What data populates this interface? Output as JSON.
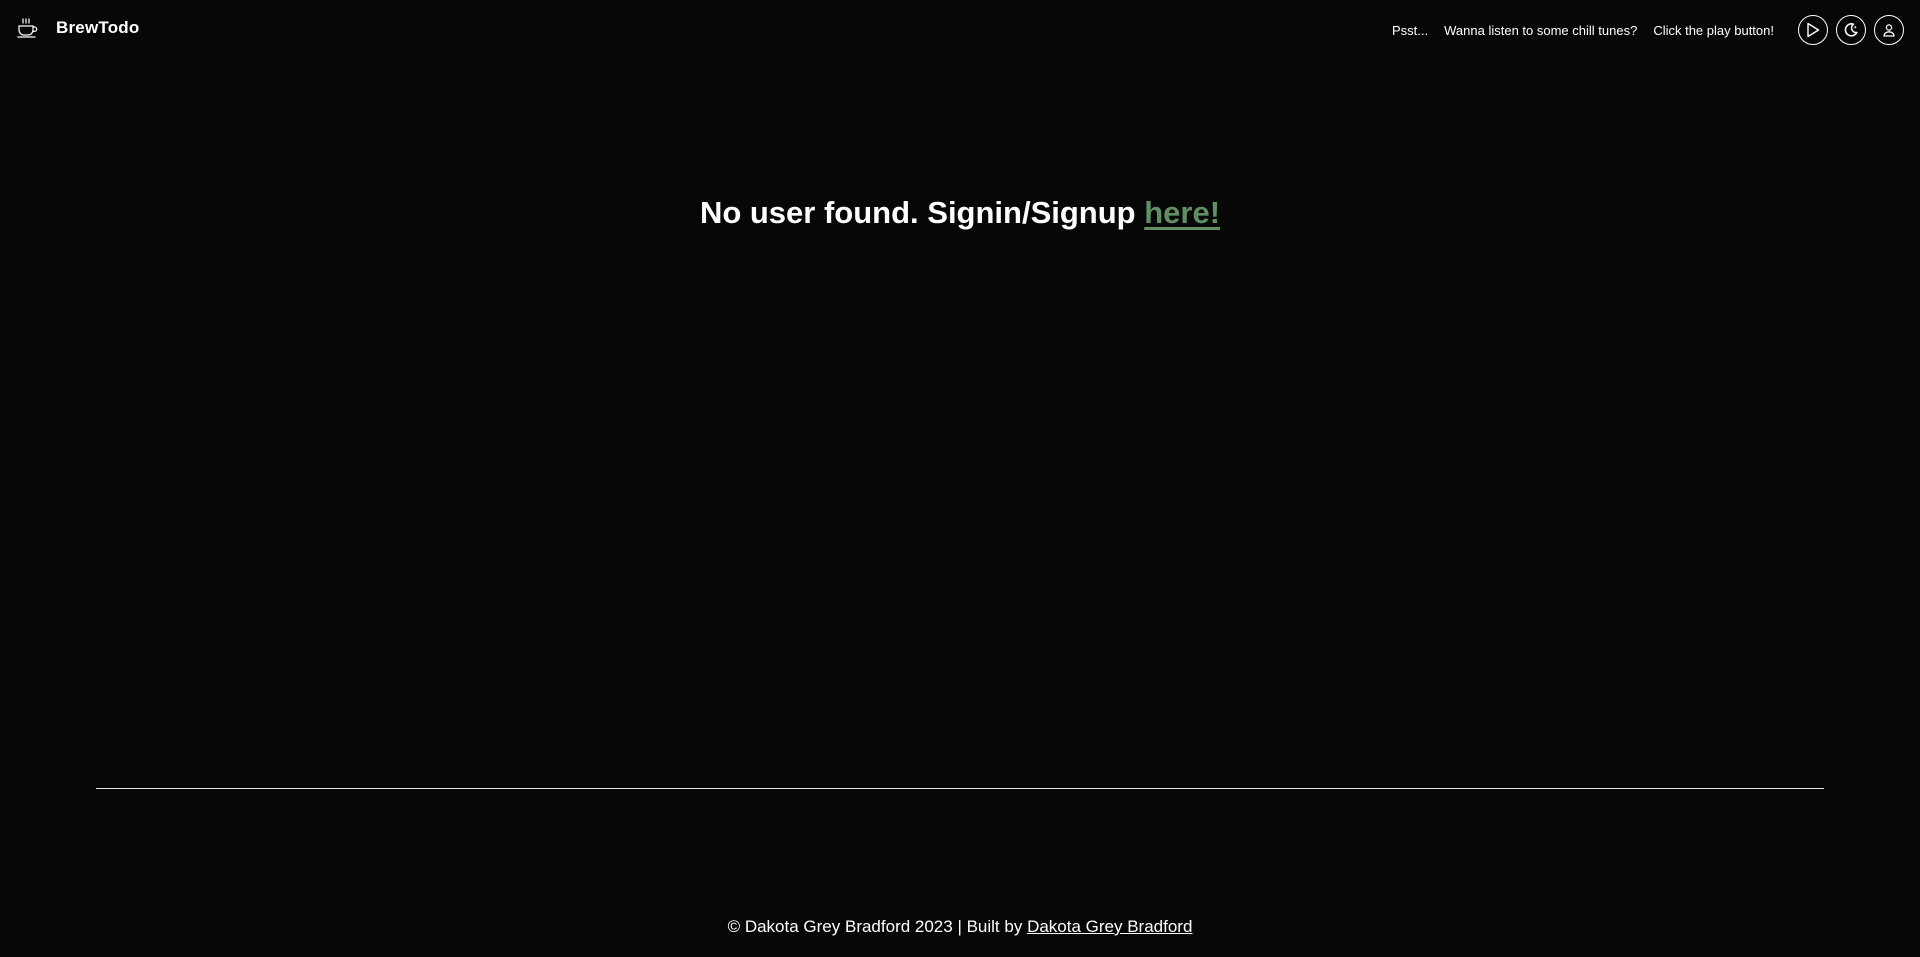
{
  "header": {
    "brand_name": "BrewTodo",
    "brand_icon": "coffee-cup-icon",
    "tips": [
      "Psst...",
      "Wanna listen to some chill tunes?",
      "Click the play button!"
    ],
    "buttons": {
      "play_icon": "play-icon",
      "theme_icon": "moon-icon",
      "user_icon": "user-icon"
    }
  },
  "main": {
    "message_prefix": "No user found. Signin/Signup ",
    "link_text": "here!",
    "link_color": "#5f8f63"
  },
  "footer": {
    "copyright_text": "© Dakota Grey Bradford 2023 | Built by ",
    "author_link": "Dakota Grey Bradford"
  },
  "colors": {
    "background": "#070707",
    "text": "#ffffff",
    "accent": "#5f8f63"
  }
}
